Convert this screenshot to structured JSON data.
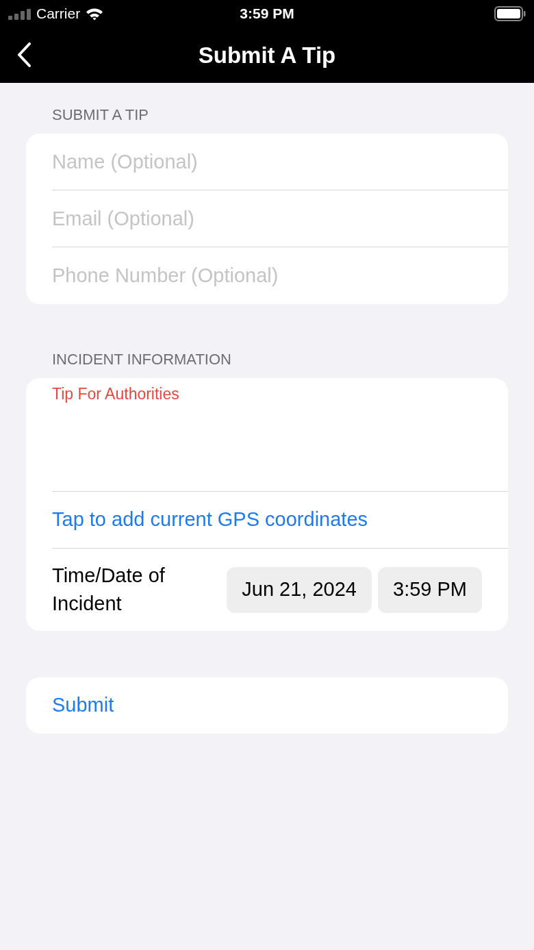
{
  "status_bar": {
    "carrier": "Carrier",
    "time": "3:59 PM"
  },
  "nav": {
    "title": "Submit A Tip"
  },
  "sections": [
    {
      "header": "SUBMIT A TIP",
      "fields": [
        {
          "placeholder": "Name (Optional)"
        },
        {
          "placeholder": "Email (Optional)"
        },
        {
          "placeholder": "Phone Number (Optional)"
        }
      ]
    },
    {
      "header": "INCIDENT INFORMATION",
      "tip_field": {
        "placeholder": "Tip For Authorities"
      },
      "gps_link": "Tap to add current GPS coordinates",
      "datetime": {
        "label": "Time/Date of Incident",
        "date": "Jun 21, 2024",
        "time": "3:59 PM"
      }
    }
  ],
  "submit": "Submit"
}
